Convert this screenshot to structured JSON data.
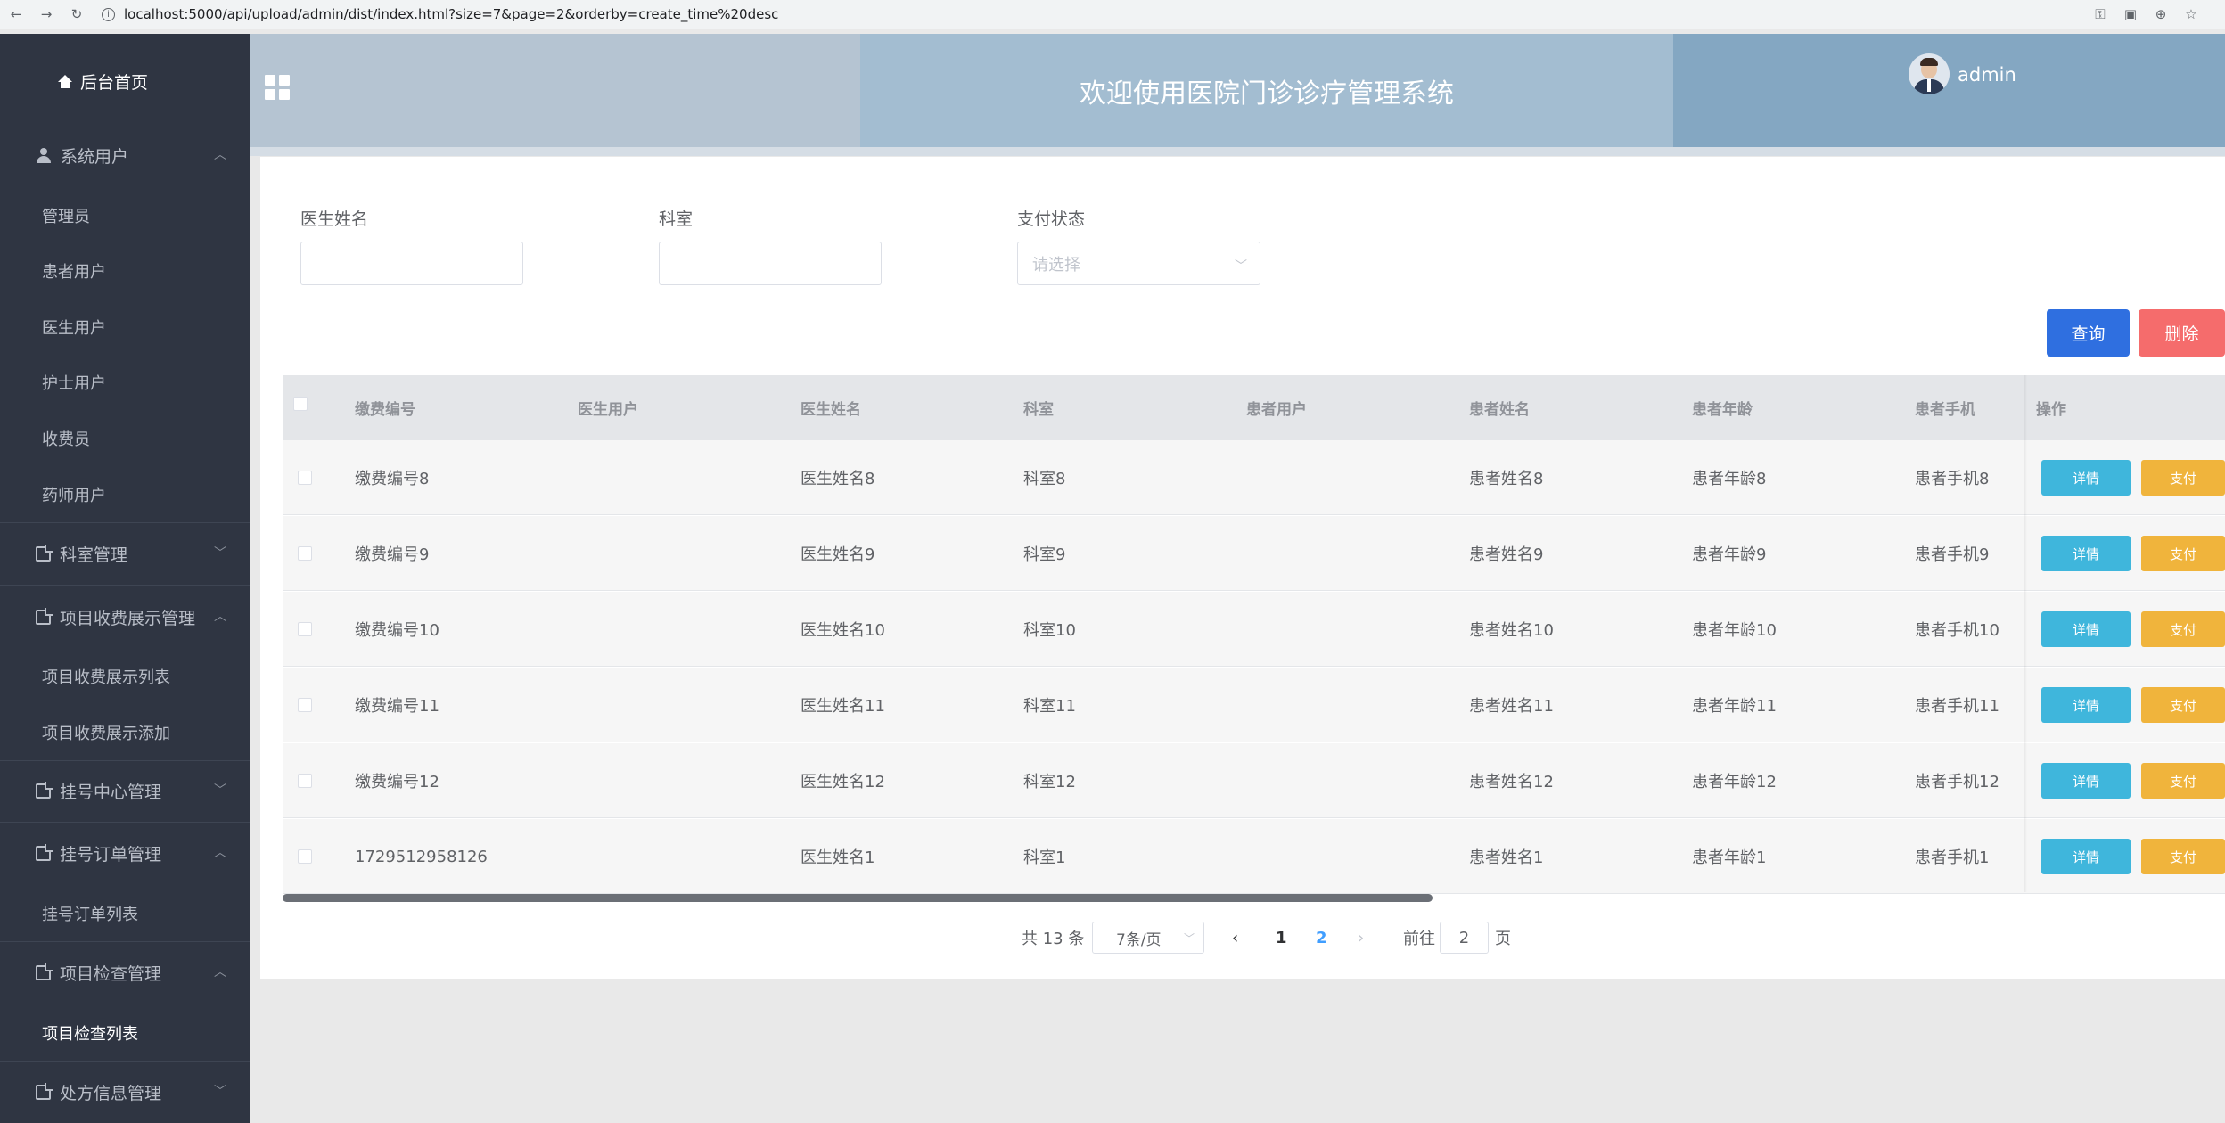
{
  "browser": {
    "url": "localhost:5000/api/upload/admin/dist/index.html?size=7&page=2&orderby=create_time%20desc"
  },
  "sidebar": {
    "home": "后台首页",
    "groups": [
      {
        "label": "系统用户",
        "expanded": true,
        "icon": "user-icon"
      },
      {
        "label": "科室管理",
        "expanded": false,
        "icon": "document-icon"
      },
      {
        "label": "项目收费展示管理",
        "expanded": true,
        "icon": "document-icon"
      },
      {
        "label": "挂号中心管理",
        "expanded": false,
        "icon": "document-icon"
      },
      {
        "label": "挂号订单管理",
        "expanded": true,
        "icon": "document-icon"
      },
      {
        "label": "项目检查管理",
        "expanded": true,
        "icon": "document-icon"
      },
      {
        "label": "处方信息管理",
        "expanded": false,
        "icon": "document-icon"
      }
    ],
    "sub_users": [
      "管理员",
      "患者用户",
      "医生用户",
      "护士用户",
      "收费员",
      "药师用户"
    ],
    "sub_fee": [
      "项目收费展示列表",
      "项目收费展示添加"
    ],
    "sub_order": [
      "挂号订单列表"
    ],
    "sub_check": [
      "项目检查列表"
    ]
  },
  "header": {
    "title": "欢迎使用医院门诊诊疗管理系统",
    "username": "admin"
  },
  "filters": {
    "doctor_name_label": "医生姓名",
    "doctor_name_value": "",
    "dept_label": "科室",
    "dept_value": "",
    "pay_status_label": "支付状态",
    "pay_status_placeholder": "请选择"
  },
  "actions": {
    "query": "查询",
    "delete": "删除"
  },
  "table": {
    "columns": [
      "缴费编号",
      "医生用户",
      "医生姓名",
      "科室",
      "患者用户",
      "患者姓名",
      "患者年龄",
      "患者手机",
      "操作"
    ],
    "rows": [
      [
        "缴费编号8",
        "",
        "医生姓名8",
        "科室8",
        "",
        "患者姓名8",
        "患者年龄8",
        "患者手机8"
      ],
      [
        "缴费编号9",
        "",
        "医生姓名9",
        "科室9",
        "",
        "患者姓名9",
        "患者年龄9",
        "患者手机9"
      ],
      [
        "缴费编号10",
        "",
        "医生姓名10",
        "科室10",
        "",
        "患者姓名10",
        "患者年龄10",
        "患者手机10"
      ],
      [
        "缴费编号11",
        "",
        "医生姓名11",
        "科室11",
        "",
        "患者姓名11",
        "患者年龄11",
        "患者手机11"
      ],
      [
        "缴费编号12",
        "",
        "医生姓名12",
        "科室12",
        "",
        "患者姓名12",
        "患者年龄12",
        "患者手机12"
      ],
      [
        "1729512958126",
        "",
        "医生姓名1",
        "科室1",
        "",
        "患者姓名1",
        "患者年龄1",
        "患者手机1"
      ]
    ],
    "detail_label": "详情",
    "pay_label": "支付"
  },
  "pagination": {
    "total": "共 13 条",
    "page_size": "7条/页",
    "pages": [
      "1",
      "2"
    ],
    "current": "2",
    "goto_prefix": "前往",
    "goto_value": "2",
    "goto_suffix": "页"
  },
  "colors": {
    "sidebar_bg": "#2f3542",
    "query_btn": "#2f6fe0",
    "delete_btn": "#f56c6c",
    "detail_btn": "#3fb6dc",
    "pay_btn": "#f0b43c",
    "page_active": "#409eff"
  }
}
